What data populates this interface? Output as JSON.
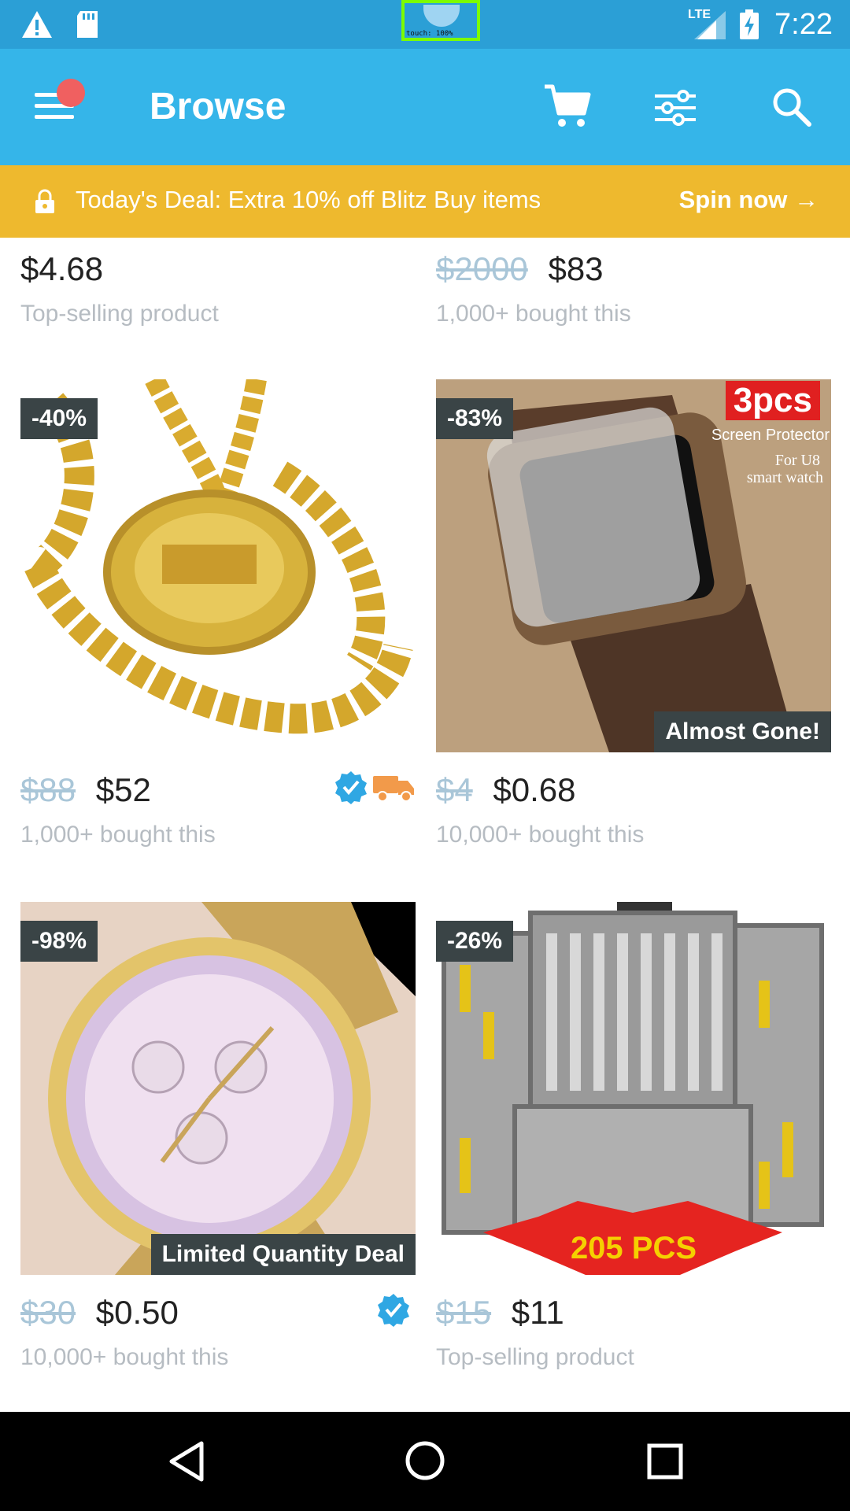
{
  "statusbar": {
    "time": "7:22",
    "network": "LTE",
    "touch_label": "touch: 100%",
    "icons": [
      "warning-icon",
      "sd-card-icon",
      "signal-icon",
      "battery-charging-icon"
    ]
  },
  "appbar": {
    "title": "Browse",
    "icons": [
      "menu-icon",
      "cart-icon",
      "filter-icon",
      "search-icon"
    ]
  },
  "deal_banner": {
    "text": "Today's Deal: Extra 10% off Blitz Buy items",
    "cta": "Spin now →"
  },
  "products_top": [
    {
      "old_price": "",
      "price": "$4.68",
      "subtitle": "Top-selling product"
    },
    {
      "old_price": "$2000",
      "price": "$83",
      "subtitle": "1,000+ bought this"
    }
  ],
  "products": [
    {
      "badge": "-40%",
      "old_price": "$88",
      "price": "$52",
      "subtitle": "1,000+ bought this",
      "verified": true,
      "fast_shipping": true,
      "overlay": ""
    },
    {
      "badge": "-83%",
      "old_price": "$4",
      "price": "$0.68",
      "subtitle": "10,000+ bought this",
      "verified": false,
      "fast_shipping": false,
      "overlay": "Almost Gone!",
      "image_text": [
        "3pcs",
        "Screen Protector",
        "For U8",
        "smart watch"
      ]
    },
    {
      "badge": "-98%",
      "old_price": "$30",
      "price": "$0.50",
      "subtitle": "10,000+ bought this",
      "verified": true,
      "fast_shipping": false,
      "overlay": "Limited Quantity Deal"
    },
    {
      "badge": "-26%",
      "old_price": "$15",
      "price": "$11",
      "subtitle": "Top-selling product",
      "verified": false,
      "fast_shipping": false,
      "overlay": "",
      "image_text": [
        "205 PCS"
      ]
    }
  ],
  "colors": {
    "status_bar": "#2b9fd6",
    "app_bar": "#35b5e9",
    "deal_banner": "#eeb92e",
    "badge": "#3a4446",
    "verified": "#2fa7e3",
    "truck": "#f29a4a"
  }
}
